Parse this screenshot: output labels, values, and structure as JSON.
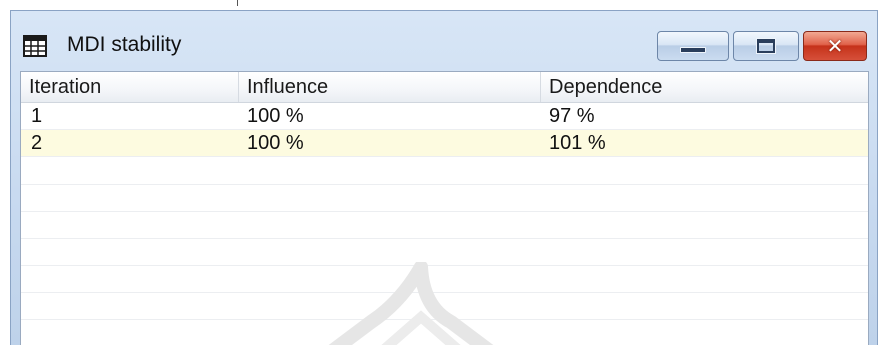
{
  "window": {
    "title": "MDI stability",
    "icon": "grid-table-icon",
    "controls": [
      "minimize-icon",
      "maximize-icon",
      "close-icon"
    ]
  },
  "table": {
    "columns": [
      "Iteration",
      "Influence",
      "Dependence"
    ],
    "rows": [
      {
        "iteration": "1",
        "influence": "100 %",
        "dependence": "97 %"
      },
      {
        "iteration": "2",
        "influence": "100 %",
        "dependence": "101 %"
      }
    ],
    "selected_row_index": 1
  },
  "colors": {
    "selected_row": "#fdfbe0",
    "close_button": "#d6503a",
    "title_bar": "#c8daf0"
  }
}
